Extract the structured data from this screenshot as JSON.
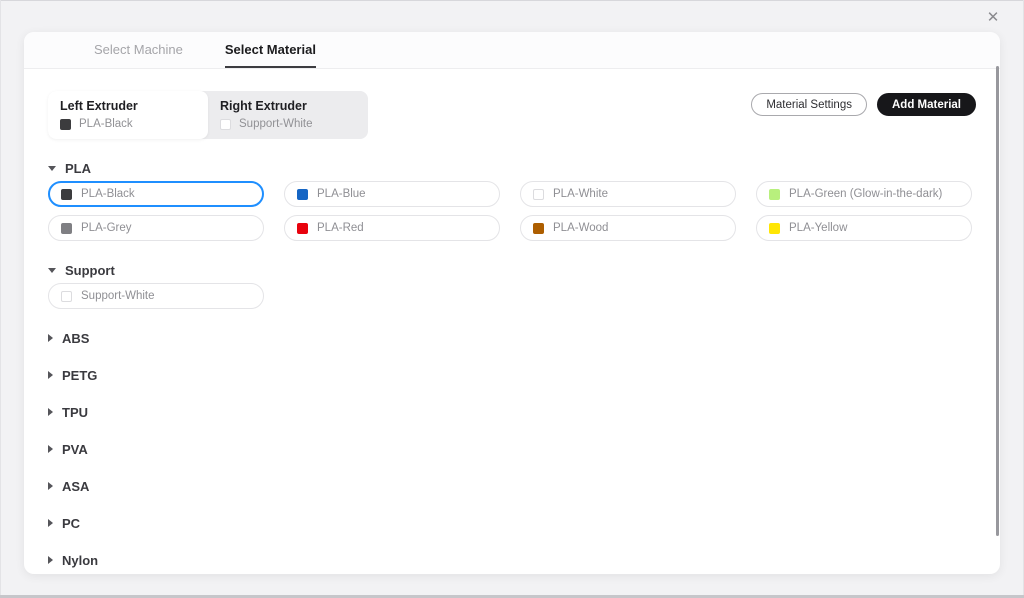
{
  "window": {
    "close_icon": "✕"
  },
  "tabs": [
    {
      "label": "Select Machine",
      "active": false
    },
    {
      "label": "Select Material",
      "active": true
    }
  ],
  "extruders": {
    "left": {
      "title": "Left Extruder",
      "material": "PLA-Black",
      "color": "#3c3c3e",
      "light": false,
      "selected": true
    },
    "right": {
      "title": "Right Extruder",
      "material": "Support-White",
      "color": "#ffffff",
      "light": true,
      "selected": false
    }
  },
  "toolbar": {
    "material_settings_label": "Material Settings",
    "add_material_label": "Add Material"
  },
  "accent_color": "#1f8fff",
  "sections": [
    {
      "name": "PLA",
      "expanded": true,
      "materials": [
        {
          "name": "PLA-Black",
          "color": "#3c3c3e",
          "light": false,
          "selected": true
        },
        {
          "name": "PLA-Blue",
          "color": "#1565c4",
          "light": false,
          "selected": false
        },
        {
          "name": "PLA-White",
          "color": "#ffffff",
          "light": true,
          "selected": false
        },
        {
          "name": "PLA-Green (Glow-in-the-dark)",
          "color": "#b8f07d",
          "light": false,
          "selected": false
        },
        {
          "name": "PLA-Grey",
          "color": "#7f7f83",
          "light": false,
          "selected": false
        },
        {
          "name": "PLA-Red",
          "color": "#e8020d",
          "light": false,
          "selected": false
        },
        {
          "name": "PLA-Wood",
          "color": "#ad5e00",
          "light": false,
          "selected": false
        },
        {
          "name": "PLA-Yellow",
          "color": "#ffe604",
          "light": false,
          "selected": false
        }
      ]
    },
    {
      "name": "Support",
      "expanded": true,
      "materials": [
        {
          "name": "Support-White",
          "color": "#ffffff",
          "light": true,
          "selected": false
        }
      ]
    },
    {
      "name": "ABS",
      "expanded": false,
      "materials": []
    },
    {
      "name": "PETG",
      "expanded": false,
      "materials": []
    },
    {
      "name": "TPU",
      "expanded": false,
      "materials": []
    },
    {
      "name": "PVA",
      "expanded": false,
      "materials": []
    },
    {
      "name": "ASA",
      "expanded": false,
      "materials": []
    },
    {
      "name": "PC",
      "expanded": false,
      "materials": []
    },
    {
      "name": "Nylon",
      "expanded": false,
      "materials": []
    }
  ]
}
